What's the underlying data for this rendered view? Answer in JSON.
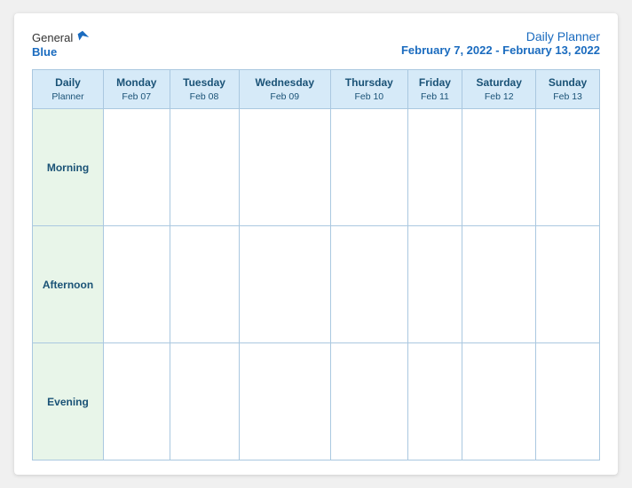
{
  "header": {
    "logo_general": "General",
    "logo_blue": "Blue",
    "title_line1": "Daily Planner",
    "title_line2": "February 7, 2022 - February 13, 2022"
  },
  "table": {
    "header_col0_line1": "Daily",
    "header_col0_line2": "Planner",
    "columns": [
      {
        "day": "Monday",
        "date": "Feb 07"
      },
      {
        "day": "Tuesday",
        "date": "Feb 08"
      },
      {
        "day": "Wednesday",
        "date": "Feb 09"
      },
      {
        "day": "Thursday",
        "date": "Feb 10"
      },
      {
        "day": "Friday",
        "date": "Feb 11"
      },
      {
        "day": "Saturday",
        "date": "Feb 12"
      },
      {
        "day": "Sunday",
        "date": "Feb 13"
      }
    ],
    "rows": [
      {
        "label": "Morning"
      },
      {
        "label": "Afternoon"
      },
      {
        "label": "Evening"
      }
    ]
  }
}
